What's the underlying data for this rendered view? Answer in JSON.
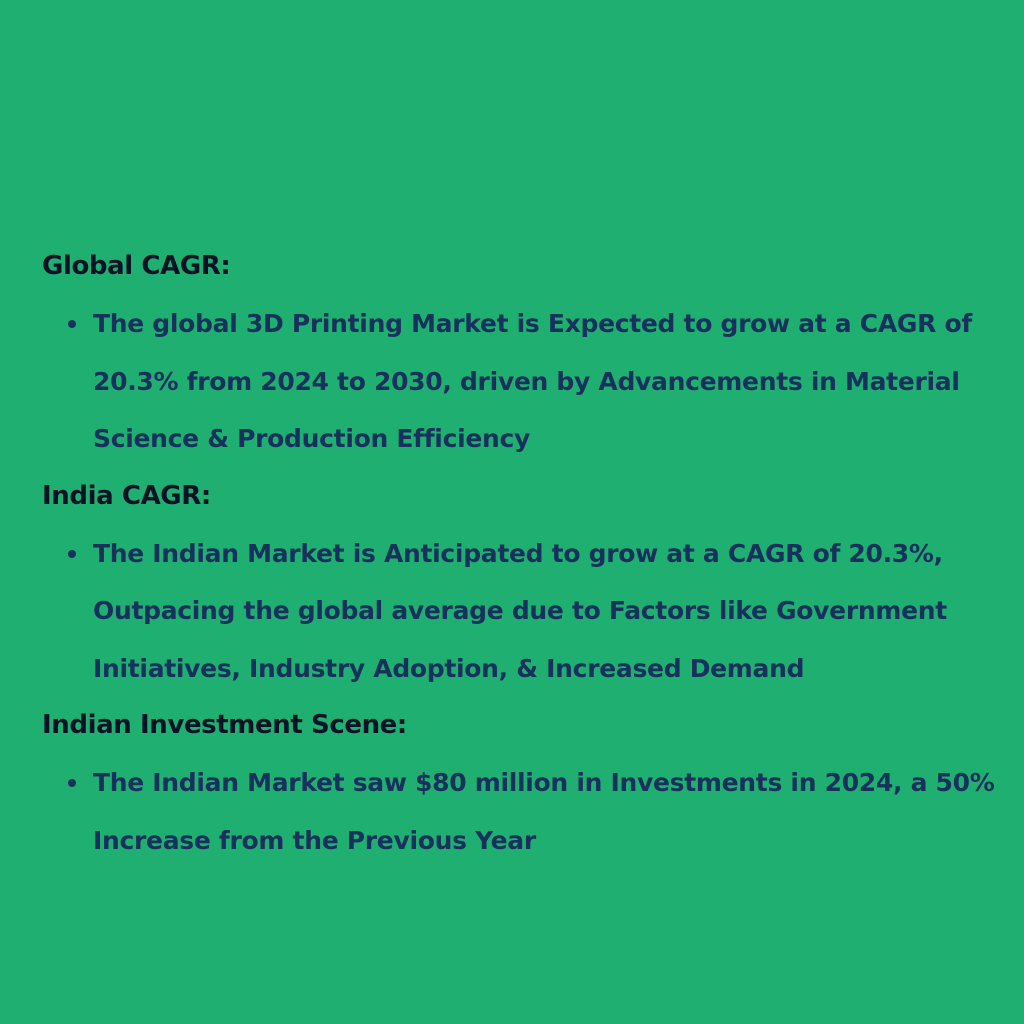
{
  "sections": [
    {
      "heading": "Global CAGR:",
      "bullets": [
        "The global 3D Printing Market is Expected to grow at a CAGR of 20.3% from 2024 to 2030, driven by Advancements in Material Science & Production Efficiency"
      ]
    },
    {
      "heading": "India CAGR:",
      "bullets": [
        "The Indian Market is Anticipated to grow at a CAGR of 20.3%, Outpacing the global average due to Factors like Government Initiatives, Industry Adoption, & Increased Demand"
      ]
    },
    {
      "heading": "Indian Investment Scene:",
      "bullets": [
        "The Indian Market saw $80 million in Investments in 2024, a 50% Increase from the Previous Year"
      ]
    }
  ],
  "colors": {
    "background": "#1faf71",
    "heading": "#0b1226",
    "body": "#17305c"
  }
}
